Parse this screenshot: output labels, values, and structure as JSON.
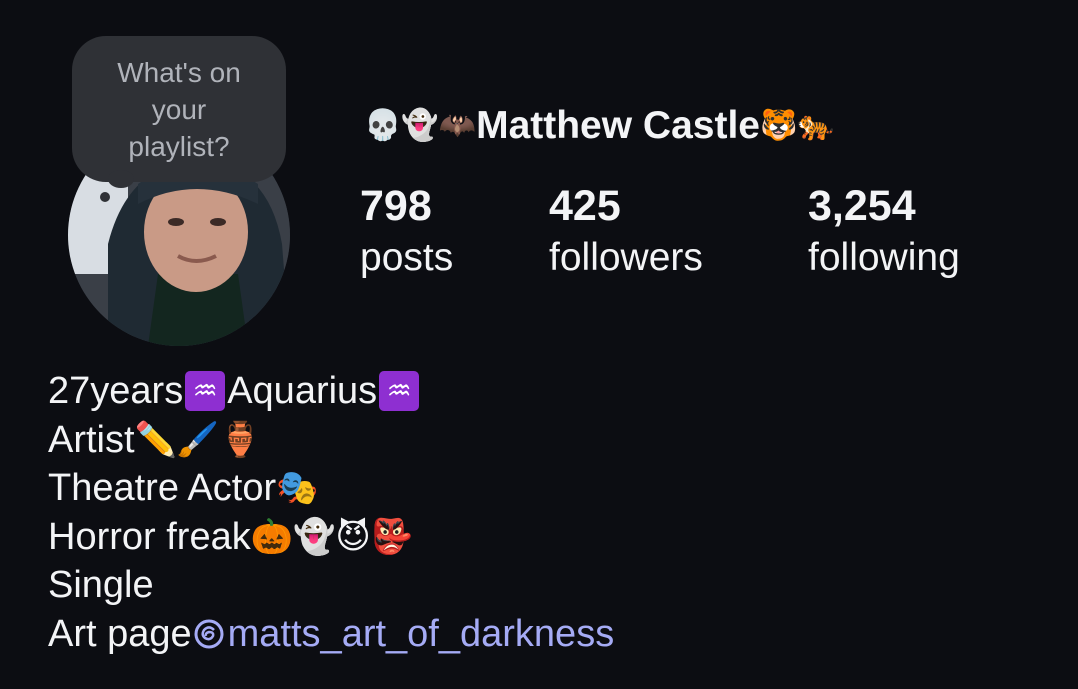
{
  "profile": {
    "note_text": "What's on your playlist?",
    "name_prefix_emojis": [
      "💀",
      "👻",
      "🦇"
    ],
    "display_name": "Matthew Castle",
    "name_suffix_emojis": [
      "🐯",
      "🐅"
    ],
    "stats": {
      "posts": {
        "value": "798",
        "label": "posts"
      },
      "followers": {
        "value": "425",
        "label": "followers"
      },
      "following": {
        "value": "3,254",
        "label": "following"
      }
    },
    "bio": {
      "line1_text_a": "27years ",
      "line1_sign": "♒",
      "line1_text_b": "Aquarius ",
      "line2_text": "Artist",
      "line2_emojis": "✏️🖌️🏺",
      "line3_text": "Theatre Actor",
      "line3_emojis": "🎭",
      "line4_text": "Horror freak",
      "line4_emojis": "🎃👻😈👺",
      "line5_text": "Single",
      "line6_text": "Art page ",
      "link_handle": "matts_art_of_darkness"
    }
  },
  "colors": {
    "background": "#0c0d12",
    "text": "#f3f4f6",
    "note_bubble": "#2f3136",
    "note_text": "#b0b3ba",
    "link": "#a5abf5",
    "aquarius_sign_bg": "#8e2fd1"
  }
}
